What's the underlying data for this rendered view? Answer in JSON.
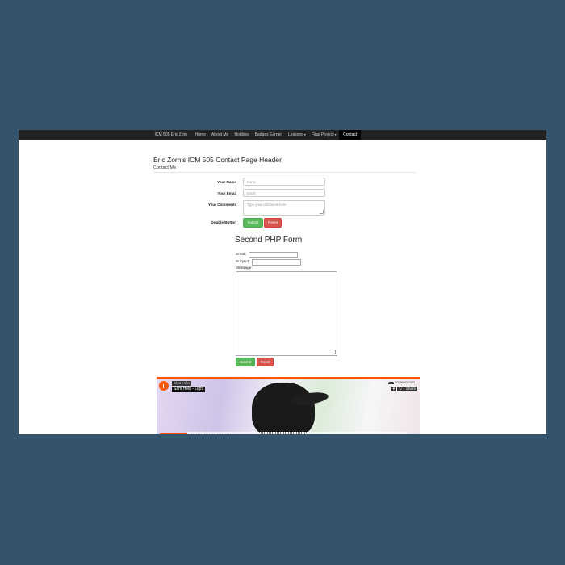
{
  "nav": {
    "brand": "ICM 505 Eric Zorn",
    "items": [
      {
        "label": "Home"
      },
      {
        "label": "About Me"
      },
      {
        "label": "Hobbies"
      },
      {
        "label": "Badges Earned"
      },
      {
        "label": "Lessons",
        "dropdown": true
      },
      {
        "label": "Final Project",
        "dropdown": true
      },
      {
        "label": "Contact",
        "active": true
      }
    ]
  },
  "header": {
    "title": "Eric Zorn's ICM 505 Contact Page Header",
    "subtitle": "Contact Me"
  },
  "form1": {
    "name_label": "Your Name",
    "name_placeholder": "Name",
    "email_label": "Your Email",
    "email_placeholder": "Email",
    "comments_label": "Your Comments",
    "comments_placeholder": "Type your comments here",
    "buttons_label": "Double Button",
    "submit": "Submit",
    "reset": "Reset"
  },
  "form2": {
    "title": "Second PHP Form",
    "email_label": "Email:",
    "subject_label": "Subject:",
    "message_label": "Message:",
    "submit": "Submit",
    "reset": "Reset"
  },
  "player": {
    "artist": "Cleo Helo",
    "track": "Sam Helo - Light",
    "brand": "SOUNDCLOUD",
    "like": "♥",
    "repost": "↻",
    "share": "Share"
  },
  "colors": {
    "background": "#34546d",
    "navbar": "#222222",
    "submit": "#5cb85c",
    "reset": "#d9534f",
    "soundcloud": "#ff5500"
  }
}
